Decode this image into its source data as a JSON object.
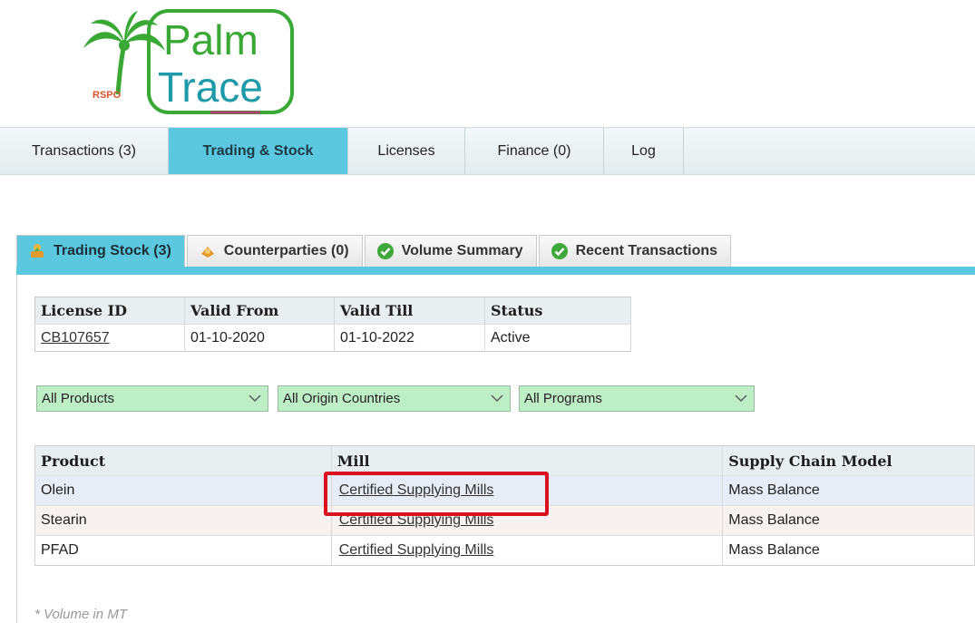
{
  "logo": {
    "line1": "Palm",
    "line2": "Trace",
    "badge": "RSPO"
  },
  "topnav": [
    {
      "label": "Transactions (3)",
      "active": false
    },
    {
      "label": "Trading & Stock",
      "active": true
    },
    {
      "label": "Licenses",
      "active": false
    },
    {
      "label": "Finance (0)",
      "active": false
    },
    {
      "label": "Log",
      "active": false
    }
  ],
  "subtabs": [
    {
      "label": "Trading Stock (3)",
      "icon": "stock-icon",
      "active": true
    },
    {
      "label": "Counterparties (0)",
      "icon": "counterparties-icon",
      "active": false
    },
    {
      "label": "Volume Summary",
      "icon": "check-circle-icon",
      "active": false
    },
    {
      "label": "Recent Transactions",
      "icon": "check-circle-icon",
      "active": false
    }
  ],
  "license": {
    "headers": [
      "License ID",
      "Valid From",
      "Valid Till",
      "Status"
    ],
    "row": {
      "license_id": "CB107657",
      "valid_from": "01-10-2020",
      "valid_till": "01-10-2022",
      "status": "Active"
    }
  },
  "filters": {
    "products": "All Products",
    "countries": "All Origin Countries",
    "programs": "All Programs"
  },
  "stock": {
    "headers": [
      "Product",
      "Mill",
      "Supply Chain Model"
    ],
    "rows": [
      {
        "product": "Olein",
        "mill": "Certified Supplying Mills",
        "model": "Mass Balance"
      },
      {
        "product": "Stearin",
        "mill": "Certified Supplying Mills",
        "model": "Mass Balance"
      },
      {
        "product": "PFAD",
        "mill": "Certified Supplying Mills",
        "model": "Mass Balance"
      }
    ]
  },
  "note": "* Volume in MT",
  "colors": {
    "accent": "#5bc8e0",
    "filter_bg": "#bdeec6",
    "highlight": "#d9121f",
    "logo_green": "#3aa835",
    "logo_teal": "#1f9aa8"
  }
}
